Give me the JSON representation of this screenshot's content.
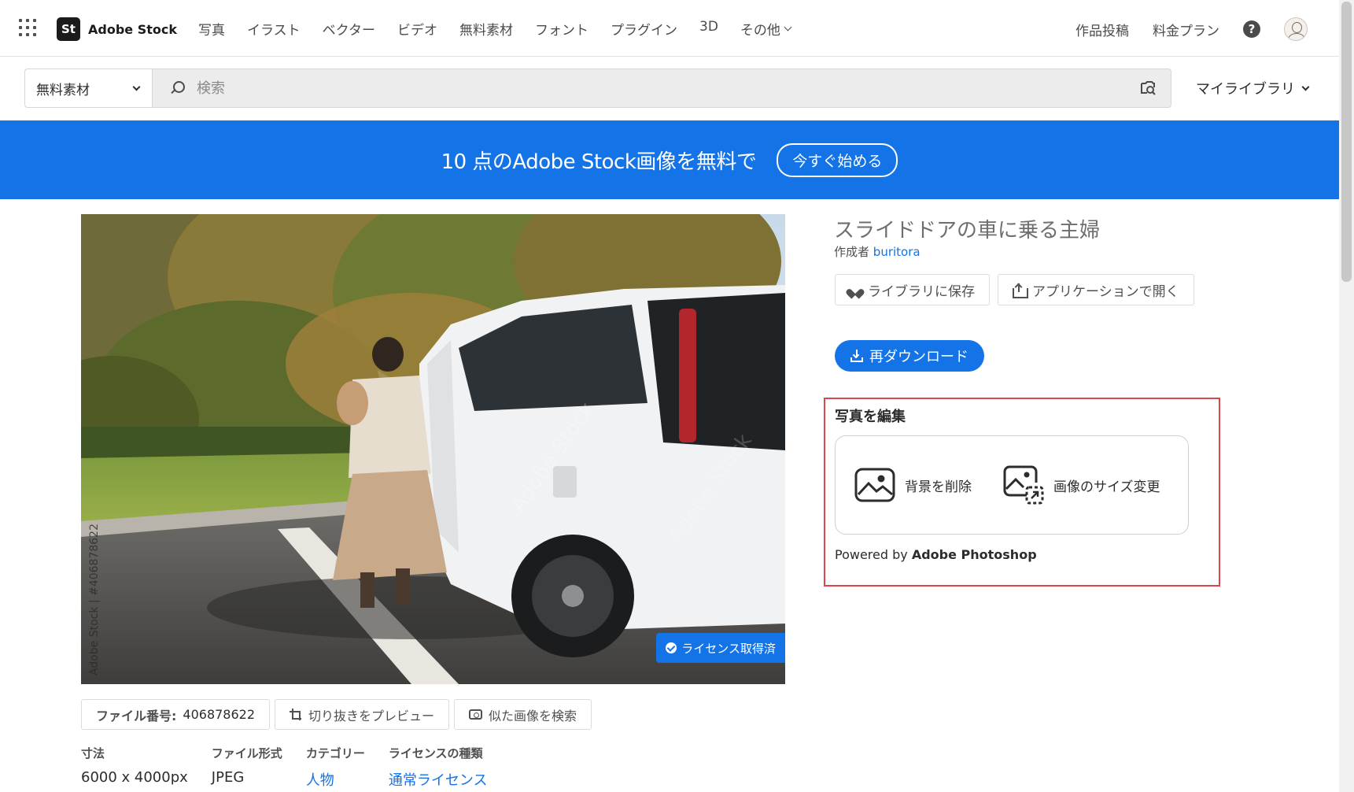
{
  "nav": {
    "brand_logo": "St",
    "brand_name": "Adobe Stock",
    "links": [
      "写真",
      "イラスト",
      "ベクター",
      "ビデオ",
      "無料素材",
      "フォント",
      "プラグイン",
      "3D"
    ],
    "more": "その他",
    "contribute": "作品投稿",
    "pricing": "料金プラン",
    "help": "?"
  },
  "search": {
    "filter": "無料素材",
    "placeholder": "検索",
    "my_library": "マイライブラリ"
  },
  "banner": {
    "text": "10 点のAdobe Stock画像を無料で",
    "cta": "今すぐ始める"
  },
  "asset": {
    "title": "スライドドアの車に乗る主婦",
    "author_prefix": "作成者",
    "author": "buritora",
    "save_library": "ライブラリに保存",
    "open_in_app": "アプリケーションで開く",
    "redownload": "再ダウンロード",
    "licensed_badge": "ライセンス取得済",
    "side_watermark": "Adobe Stock | #406878622",
    "file_number_label": "ファイル番号:",
    "file_number": "406878622",
    "preview_crop": "切り抜きをプレビュー",
    "find_similar": "似た画像を検索",
    "meta": [
      {
        "label": "寸法",
        "value": "6000 x 4000px",
        "link": false
      },
      {
        "label": "ファイル形式",
        "value": "JPEG",
        "link": false
      },
      {
        "label": "カテゴリー",
        "value": "人物",
        "link": true
      },
      {
        "label": "ライセンスの種類",
        "value": "通常ライセンス",
        "link": true
      }
    ]
  },
  "edit": {
    "title": "写真を編集",
    "remove_bg": "背景を削除",
    "resize": "画像のサイズ変更",
    "powered_prefix": "Powered by",
    "powered_brand": "Adobe Photoshop"
  },
  "colors": {
    "accent": "#1473e6",
    "highlight_frame": "#d9474b"
  }
}
